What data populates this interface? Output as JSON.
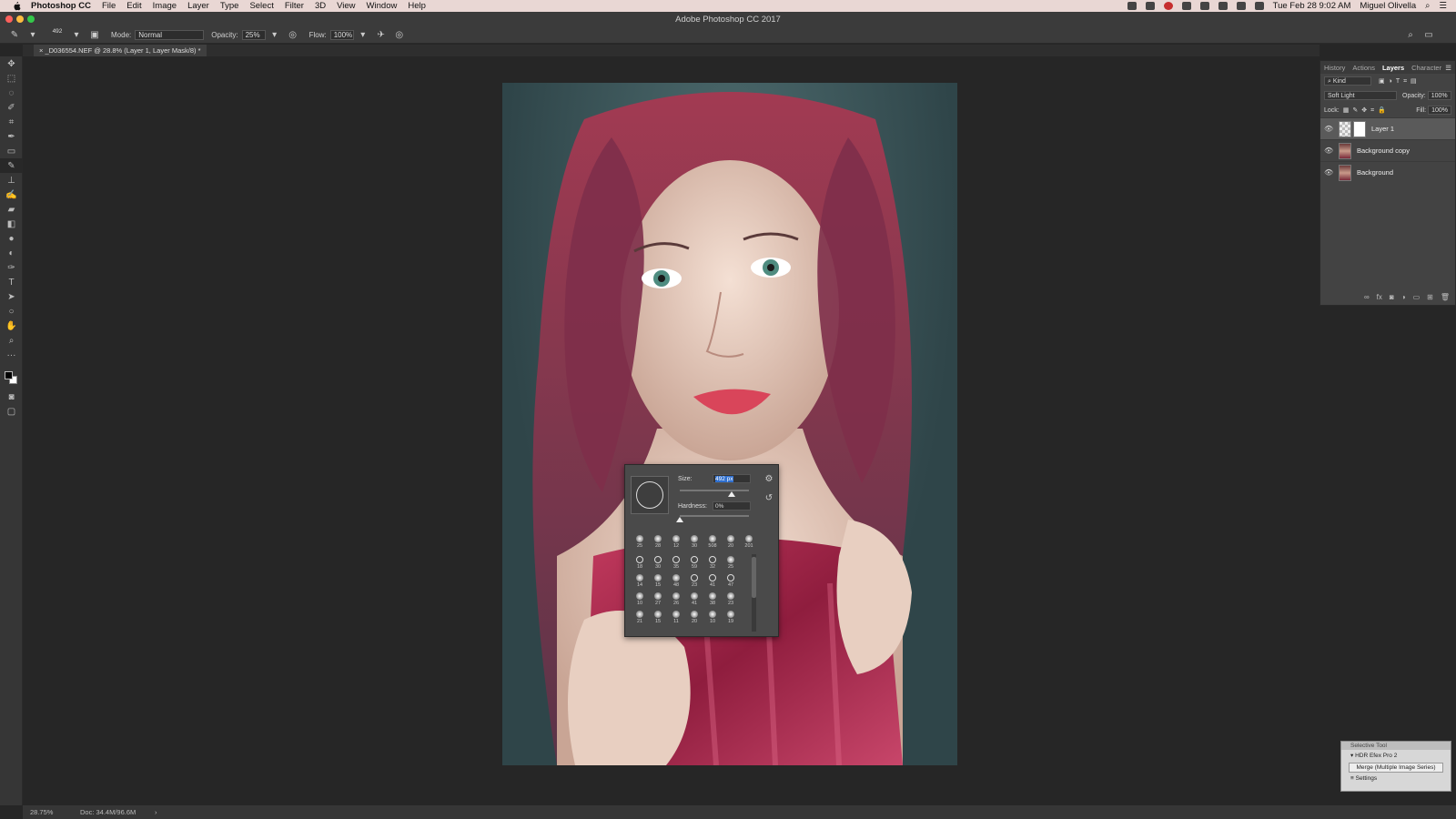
{
  "menubar": {
    "app_name": "Photoshop CC",
    "items": [
      "File",
      "Edit",
      "Image",
      "Layer",
      "Type",
      "Select",
      "Filter",
      "3D",
      "View",
      "Window",
      "Help"
    ],
    "datetime": "Tue Feb 28  9:02 AM",
    "user": "Miguel Olivella"
  },
  "window": {
    "title": "Adobe Photoshop CC 2017"
  },
  "options": {
    "brush_size": "492",
    "mode_label": "Mode:",
    "mode_value": "Normal",
    "opacity_label": "Opacity:",
    "opacity_value": "25%",
    "flow_label": "Flow:",
    "flow_value": "100%"
  },
  "document": {
    "tab_label": "_D036554.NEF @ 28.8% (Layer 1, Layer Mask/8) *"
  },
  "statusbar": {
    "zoom": "28.75%",
    "doc_size": "Doc: 34.4M/96.6M"
  },
  "panels": {
    "tabs": [
      "History",
      "Actions",
      "Layers",
      "Character"
    ],
    "active_tab": "Layers",
    "filter_kind": "Kind",
    "blend_mode": "Soft Light",
    "opacity_label": "Opacity:",
    "opacity_value": "100%",
    "lock_label": "Lock:",
    "fill_label": "Fill:",
    "fill_value": "100%",
    "layers": [
      {
        "name": "Layer 1"
      },
      {
        "name": "Background copy"
      },
      {
        "name": "Background"
      }
    ]
  },
  "brush_picker": {
    "size_label": "Size:",
    "size_value": "492 px",
    "hardness_label": "Hardness:",
    "hardness_value": "0%",
    "size_level": 0.75,
    "hardness_level": 0.0,
    "presets_row": [
      "25",
      "28",
      "12",
      "30",
      "508",
      "20",
      "201"
    ],
    "grid_rows": [
      [
        "18",
        "30",
        "35",
        "59",
        "32",
        "25"
      ],
      [
        "14",
        "15",
        "48",
        "23",
        "41",
        "47"
      ],
      [
        "10",
        "27",
        "26",
        "41",
        "38",
        "23"
      ],
      [
        "21",
        "15",
        "11",
        "20",
        "10",
        "19"
      ]
    ]
  },
  "selective_tool": {
    "title": "Selective Tool",
    "item": "HDR Efex Pro 2",
    "button": "Merge (Multiple Image Series)",
    "settings": "Settings"
  }
}
